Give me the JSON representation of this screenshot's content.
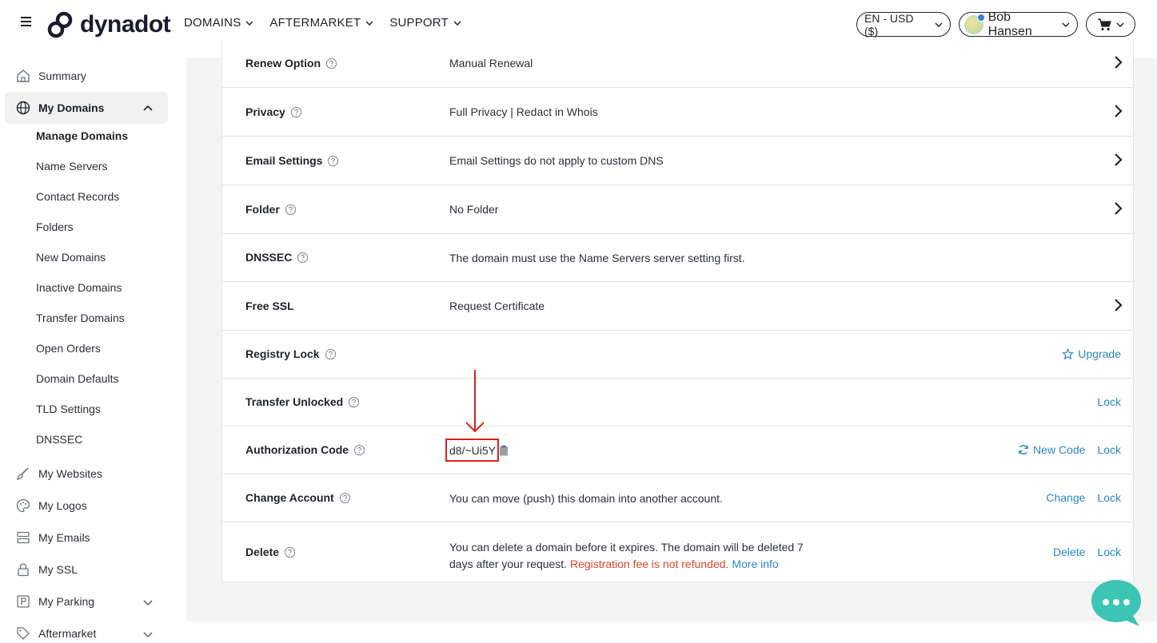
{
  "header": {
    "brand": "dynadot",
    "nav": [
      {
        "label": "DOMAINS"
      },
      {
        "label": "AFTERMARKET"
      },
      {
        "label": "SUPPORT"
      }
    ],
    "language_currency": "EN - USD ($)",
    "user_name": "Bob Hansen"
  },
  "sidebar": {
    "items": [
      {
        "label": "Summary"
      },
      {
        "label": "My Domains"
      },
      {
        "label": "My Websites"
      },
      {
        "label": "My Logos"
      },
      {
        "label": "My Emails"
      },
      {
        "label": "My SSL"
      },
      {
        "label": "My Parking"
      },
      {
        "label": "Aftermarket"
      }
    ],
    "sub_items": [
      {
        "label": "Manage Domains"
      },
      {
        "label": "Name Servers"
      },
      {
        "label": "Contact Records"
      },
      {
        "label": "Folders"
      },
      {
        "label": "New Domains"
      },
      {
        "label": "Inactive Domains"
      },
      {
        "label": "Transfer Domains"
      },
      {
        "label": "Open Orders"
      },
      {
        "label": "Domain Defaults"
      },
      {
        "label": "TLD Settings"
      },
      {
        "label": "DNSSEC"
      }
    ]
  },
  "settings": {
    "renew_option": {
      "label": "Renew Option",
      "value": "Manual Renewal"
    },
    "privacy": {
      "label": "Privacy",
      "value": "Full Privacy | Redact in Whois"
    },
    "email_settings": {
      "label": "Email Settings",
      "value": "Email Settings do not apply to custom DNS"
    },
    "folder": {
      "label": "Folder",
      "value": "No Folder"
    },
    "dnssec": {
      "label": "DNSSEC",
      "value": "The domain must use the Name Servers server setting first."
    },
    "free_ssl": {
      "label": "Free SSL",
      "value": "Request Certificate"
    },
    "registry_lock": {
      "label": "Registry Lock",
      "action": "Upgrade"
    },
    "transfer_unlocked": {
      "label": "Transfer Unlocked",
      "action": "Lock"
    },
    "authorization_code": {
      "label": "Authorization Code",
      "value": "d8/~Ui5Y",
      "new_code": "New Code",
      "lock": "Lock"
    },
    "change_account": {
      "label": "Change Account",
      "value": "You can move (push) this domain into another account.",
      "change": "Change",
      "lock": "Lock"
    },
    "delete": {
      "label": "Delete",
      "value_line1": "You can delete a domain before it expires. The domain will be deleted 7",
      "value_line2": "days after your request.",
      "warning": "Registration fee is not refunded.",
      "more_info": "More info",
      "delete": "Delete",
      "lock": "Lock"
    }
  },
  "colors": {
    "link": "#2b88c8",
    "warning": "#d9472b",
    "annotation": "#e02020",
    "chat": "#3cc4b4"
  }
}
